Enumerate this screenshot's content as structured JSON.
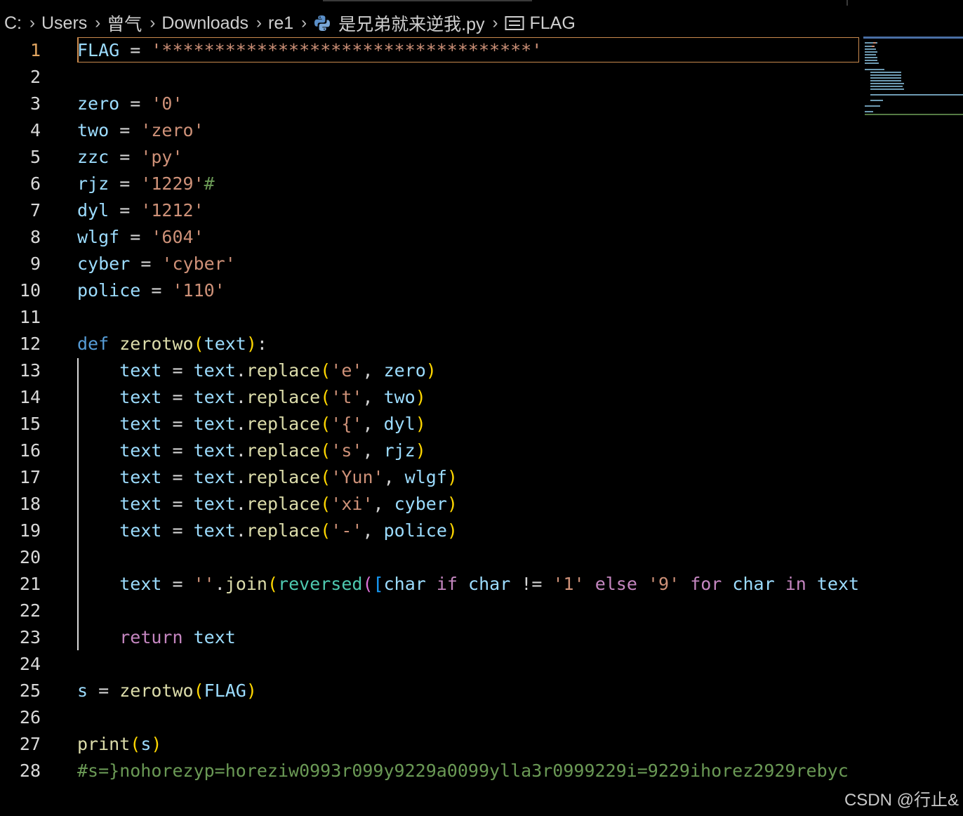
{
  "breadcrumb": {
    "items": [
      "C:",
      "Users",
      "曾气",
      "Downloads",
      "re1",
      "是兄弟就来逆我.py",
      "FLAG"
    ],
    "icons": [
      "chevron-right-icon",
      "python-file-icon",
      "symbol-variable-icon"
    ]
  },
  "colors": {
    "background": "#000000",
    "variable": "#9cdcfe",
    "string": "#ce9178",
    "keyword": "#569cd6",
    "control": "#c586c0",
    "function": "#dcdcaa",
    "comment": "#6a9955",
    "bracket1": "#ffd700",
    "bracket2": "#da70d6",
    "bracket3": "#179fff",
    "current_line_border": "#c98a4e"
  },
  "editor": {
    "active_line": 1,
    "lines": [
      {
        "n": "1",
        "tokens": [
          [
            "v",
            "FLAG"
          ],
          [
            "o",
            " = "
          ],
          [
            "s",
            "'***********************************'"
          ]
        ]
      },
      {
        "n": "2",
        "tokens": []
      },
      {
        "n": "3",
        "tokens": [
          [
            "v",
            "zero"
          ],
          [
            "o",
            " = "
          ],
          [
            "s",
            "'0'"
          ]
        ]
      },
      {
        "n": "4",
        "tokens": [
          [
            "v",
            "two"
          ],
          [
            "o",
            " = "
          ],
          [
            "s",
            "'zero'"
          ]
        ]
      },
      {
        "n": "5",
        "tokens": [
          [
            "v",
            "zzc"
          ],
          [
            "o",
            " = "
          ],
          [
            "s",
            "'py'"
          ]
        ]
      },
      {
        "n": "6",
        "tokens": [
          [
            "v",
            "rjz"
          ],
          [
            "o",
            " = "
          ],
          [
            "s",
            "'1229'"
          ],
          [
            "c",
            "#"
          ]
        ]
      },
      {
        "n": "7",
        "tokens": [
          [
            "v",
            "dyl"
          ],
          [
            "o",
            " = "
          ],
          [
            "s",
            "'1212'"
          ]
        ]
      },
      {
        "n": "8",
        "tokens": [
          [
            "v",
            "wlgf"
          ],
          [
            "o",
            " = "
          ],
          [
            "s",
            "'604'"
          ]
        ]
      },
      {
        "n": "9",
        "tokens": [
          [
            "v",
            "cyber"
          ],
          [
            "o",
            " = "
          ],
          [
            "s",
            "'cyber'"
          ]
        ]
      },
      {
        "n": "10",
        "tokens": [
          [
            "v",
            "police"
          ],
          [
            "o",
            " = "
          ],
          [
            "s",
            "'110'"
          ]
        ]
      },
      {
        "n": "11",
        "tokens": []
      },
      {
        "n": "12",
        "tokens": [
          [
            "k",
            "def"
          ],
          [
            "o",
            " "
          ],
          [
            "f",
            "zerotwo"
          ],
          [
            "b1",
            "("
          ],
          [
            "v",
            "text"
          ],
          [
            "b1",
            ")"
          ],
          [
            "o",
            ":"
          ]
        ]
      },
      {
        "n": "13",
        "tokens": [
          [
            "o",
            "    "
          ],
          [
            "v",
            "text"
          ],
          [
            "o",
            " = "
          ],
          [
            "v",
            "text"
          ],
          [
            "o",
            "."
          ],
          [
            "f",
            "replace"
          ],
          [
            "b1",
            "("
          ],
          [
            "s",
            "'e'"
          ],
          [
            "o",
            ", "
          ],
          [
            "v",
            "zero"
          ],
          [
            "b1",
            ")"
          ]
        ]
      },
      {
        "n": "14",
        "tokens": [
          [
            "o",
            "    "
          ],
          [
            "v",
            "text"
          ],
          [
            "o",
            " = "
          ],
          [
            "v",
            "text"
          ],
          [
            "o",
            "."
          ],
          [
            "f",
            "replace"
          ],
          [
            "b1",
            "("
          ],
          [
            "s",
            "'t'"
          ],
          [
            "o",
            ", "
          ],
          [
            "v",
            "two"
          ],
          [
            "b1",
            ")"
          ]
        ]
      },
      {
        "n": "15",
        "tokens": [
          [
            "o",
            "    "
          ],
          [
            "v",
            "text"
          ],
          [
            "o",
            " = "
          ],
          [
            "v",
            "text"
          ],
          [
            "o",
            "."
          ],
          [
            "f",
            "replace"
          ],
          [
            "b1",
            "("
          ],
          [
            "s",
            "'{'"
          ],
          [
            "o",
            ", "
          ],
          [
            "v",
            "dyl"
          ],
          [
            "b1",
            ")"
          ]
        ]
      },
      {
        "n": "16",
        "tokens": [
          [
            "o",
            "    "
          ],
          [
            "v",
            "text"
          ],
          [
            "o",
            " = "
          ],
          [
            "v",
            "text"
          ],
          [
            "o",
            "."
          ],
          [
            "f",
            "replace"
          ],
          [
            "b1",
            "("
          ],
          [
            "s",
            "'s'"
          ],
          [
            "o",
            ", "
          ],
          [
            "v",
            "rjz"
          ],
          [
            "b1",
            ")"
          ]
        ]
      },
      {
        "n": "17",
        "tokens": [
          [
            "o",
            "    "
          ],
          [
            "v",
            "text"
          ],
          [
            "o",
            " = "
          ],
          [
            "v",
            "text"
          ],
          [
            "o",
            "."
          ],
          [
            "f",
            "replace"
          ],
          [
            "b1",
            "("
          ],
          [
            "s",
            "'Yun'"
          ],
          [
            "o",
            ", "
          ],
          [
            "v",
            "wlgf"
          ],
          [
            "b1",
            ")"
          ]
        ]
      },
      {
        "n": "18",
        "tokens": [
          [
            "o",
            "    "
          ],
          [
            "v",
            "text"
          ],
          [
            "o",
            " = "
          ],
          [
            "v",
            "text"
          ],
          [
            "o",
            "."
          ],
          [
            "f",
            "replace"
          ],
          [
            "b1",
            "("
          ],
          [
            "s",
            "'xi'"
          ],
          [
            "o",
            ", "
          ],
          [
            "v",
            "cyber"
          ],
          [
            "b1",
            ")"
          ]
        ]
      },
      {
        "n": "19",
        "tokens": [
          [
            "o",
            "    "
          ],
          [
            "v",
            "text"
          ],
          [
            "o",
            " = "
          ],
          [
            "v",
            "text"
          ],
          [
            "o",
            "."
          ],
          [
            "f",
            "replace"
          ],
          [
            "b1",
            "("
          ],
          [
            "s",
            "'-'"
          ],
          [
            "o",
            ", "
          ],
          [
            "v",
            "police"
          ],
          [
            "b1",
            ")"
          ]
        ]
      },
      {
        "n": "20",
        "tokens": []
      },
      {
        "n": "21",
        "tokens": [
          [
            "o",
            "    "
          ],
          [
            "v",
            "text"
          ],
          [
            "o",
            " = "
          ],
          [
            "s",
            "''"
          ],
          [
            "o",
            "."
          ],
          [
            "f",
            "join"
          ],
          [
            "b1",
            "("
          ],
          [
            "t",
            "reversed"
          ],
          [
            "b2",
            "("
          ],
          [
            "b3",
            "["
          ],
          [
            "v",
            "char"
          ],
          [
            "o",
            " "
          ],
          [
            "ctl",
            "if"
          ],
          [
            "o",
            " "
          ],
          [
            "v",
            "char"
          ],
          [
            "o",
            " != "
          ],
          [
            "s",
            "'1'"
          ],
          [
            "o",
            " "
          ],
          [
            "ctl",
            "else"
          ],
          [
            "o",
            " "
          ],
          [
            "s",
            "'9'"
          ],
          [
            "o",
            " "
          ],
          [
            "ctl",
            "for"
          ],
          [
            "o",
            " "
          ],
          [
            "v",
            "char"
          ],
          [
            "o",
            " "
          ],
          [
            "ctl",
            "in"
          ],
          [
            "o",
            " "
          ],
          [
            "v",
            "text"
          ],
          [
            "b3",
            "]"
          ],
          [
            "b2",
            ")"
          ],
          [
            "b1",
            ")"
          ]
        ]
      },
      {
        "n": "22",
        "tokens": []
      },
      {
        "n": "23",
        "tokens": [
          [
            "o",
            "    "
          ],
          [
            "ctl",
            "return"
          ],
          [
            "o",
            " "
          ],
          [
            "v",
            "text"
          ]
        ]
      },
      {
        "n": "24",
        "tokens": []
      },
      {
        "n": "25",
        "tokens": [
          [
            "v",
            "s"
          ],
          [
            "o",
            " = "
          ],
          [
            "f",
            "zerotwo"
          ],
          [
            "b1",
            "("
          ],
          [
            "v",
            "FLAG"
          ],
          [
            "b1",
            ")"
          ]
        ]
      },
      {
        "n": "26",
        "tokens": []
      },
      {
        "n": "27",
        "tokens": [
          [
            "f",
            "print"
          ],
          [
            "b1",
            "("
          ],
          [
            "v",
            "s"
          ],
          [
            "b1",
            ")"
          ]
        ]
      },
      {
        "n": "28",
        "tokens": [
          [
            "c",
            "#s=}nohorezyp=horeziw0993r099y9229a0099ylla3r0999229i=9229ihorez2929rebyc"
          ]
        ]
      }
    ]
  },
  "watermark": "CSDN @行止&"
}
